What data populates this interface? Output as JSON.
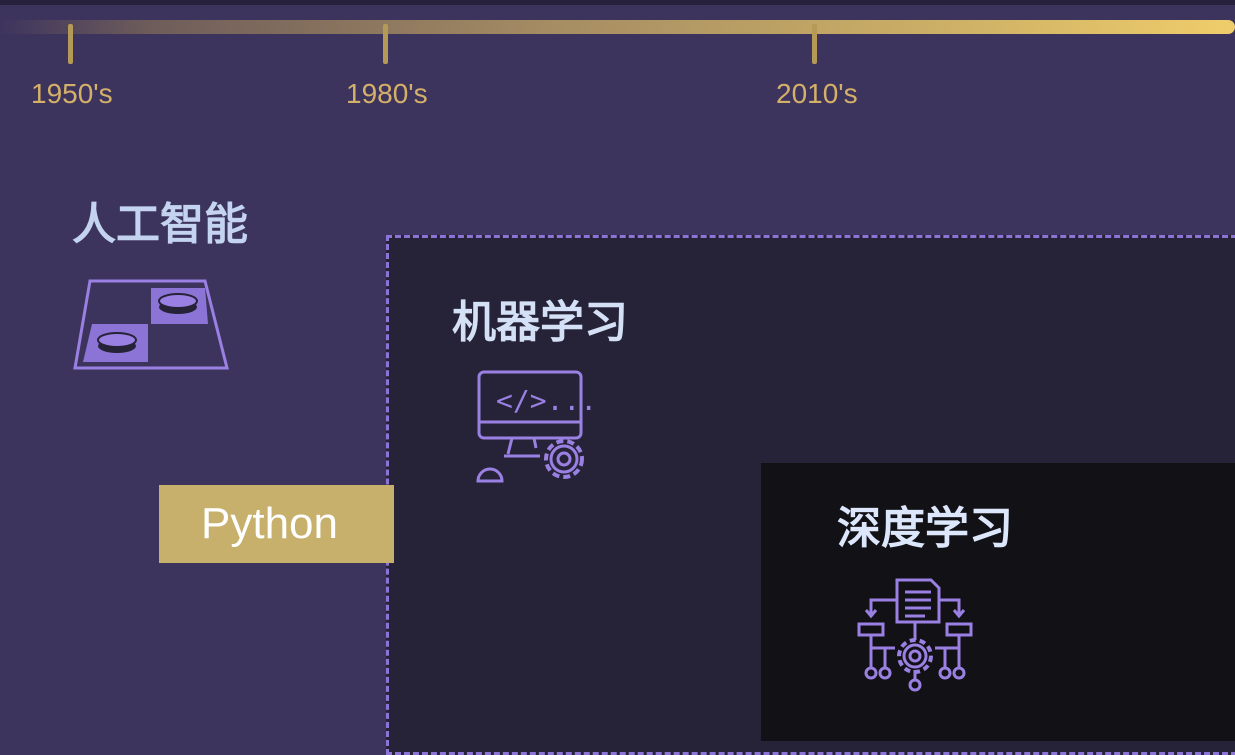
{
  "timeline": {
    "ticks": [
      "1950's",
      "1980's",
      "2010's"
    ]
  },
  "blocks": {
    "ai": {
      "title": "人工智能",
      "icon": "checkers-board-icon"
    },
    "ml": {
      "title": "机器学习",
      "icon": "computer-code-gear-icon",
      "icon_text": "</>..."
    },
    "dl": {
      "title": "深度学习",
      "icon": "document-gear-network-icon"
    }
  },
  "tag": {
    "label": "Python"
  },
  "colors": {
    "background": "#3d345e",
    "ml_background": "#262338",
    "dl_background": "#121116",
    "accent_gold": "#c7af6c",
    "icon_purple": "#9a80e2",
    "dashed_border": "#8c74d6"
  }
}
